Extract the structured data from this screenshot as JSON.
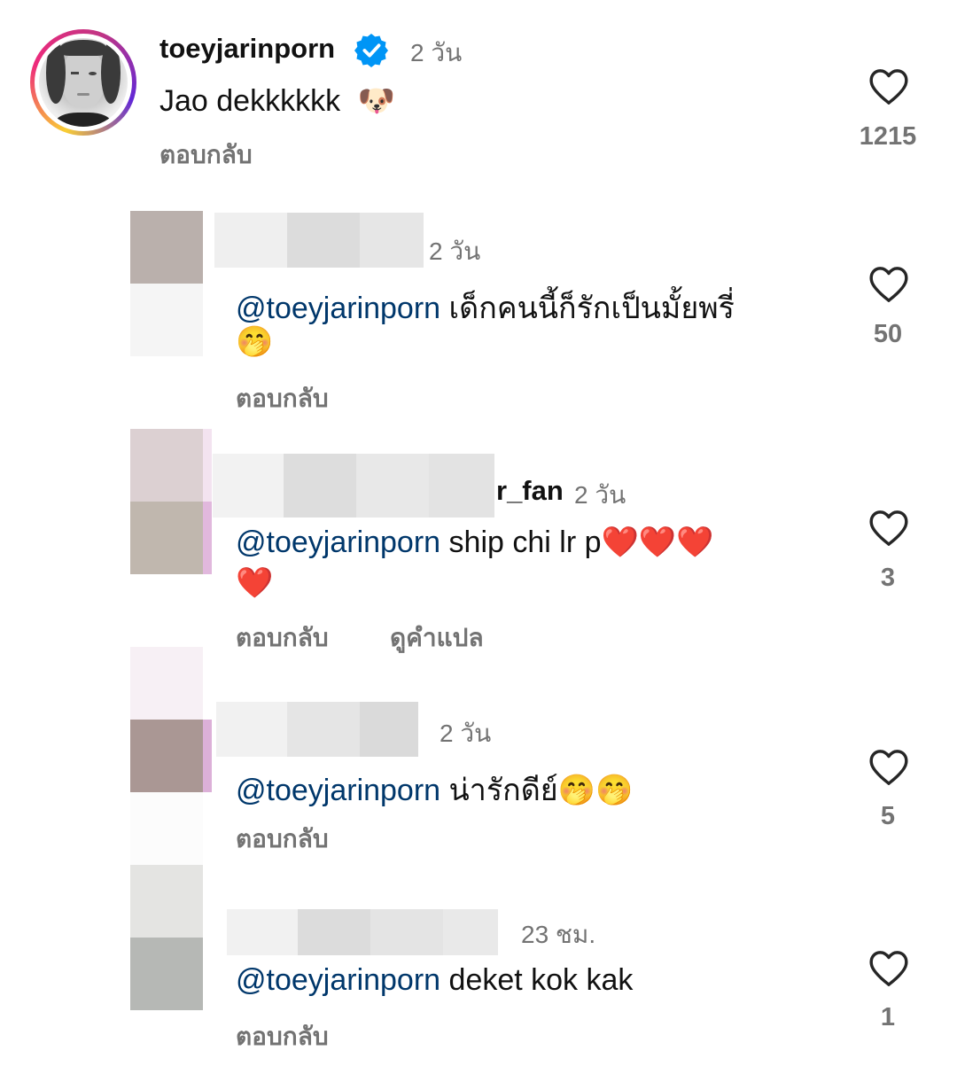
{
  "top_comment": {
    "username": "toeyjarinporn",
    "verified": true,
    "time": "2 วัน",
    "text": "Jao dekkkkkk",
    "emoji": "🐶",
    "reply_label": "ตอบกลับ",
    "likes": "1215"
  },
  "replies": [
    {
      "time": "2 วัน",
      "mention": "@toeyjarinporn",
      "text_line1": "เด็กคนนี้ก็รักเป็นมั้ยพรี่",
      "text_line2": "🤭",
      "reply_label": "ตอบกลับ",
      "likes": "50"
    },
    {
      "username_visible": "r_fan",
      "time": "2 วัน",
      "mention": "@toeyjarinporn",
      "text_line1": "ship chi lr p❤️❤️❤️",
      "text_line2": "❤️",
      "reply_label": "ตอบกลับ",
      "translate_label": "ดูคำแปล",
      "likes": "3"
    },
    {
      "time": "2 วัน",
      "mention": "@toeyjarinporn",
      "text_line1": "น่ารักดีย์🤭🤭",
      "reply_label": "ตอบกลับ",
      "likes": "5"
    },
    {
      "time": "23 ชม.",
      "mention": "@toeyjarinporn",
      "text_line1": "deket kok kak",
      "reply_label": "ตอบกลับ",
      "likes": "1"
    }
  ],
  "colors": {
    "story_ring_start": "#f9ce34",
    "story_ring_mid": "#ee2a7b",
    "story_ring_end": "#6228d7",
    "verified_badge": "#0095f6",
    "mention": "#00376b",
    "secondary_text": "#737373"
  },
  "icons": {
    "like": "heart-outline-icon",
    "verified": "verified-badge-icon"
  }
}
